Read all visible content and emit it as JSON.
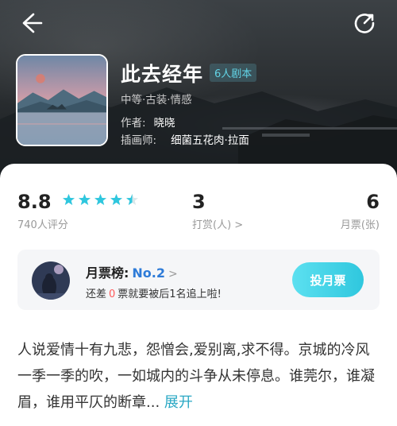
{
  "hero": {
    "title": "此去经年",
    "tag": "6人剧本",
    "genre": "中等·古装·情感",
    "author_label": "作者:",
    "author": "晓晓",
    "illustrator_label": "插画师:",
    "illustrator": "细菌五花肉·拉面"
  },
  "icons": {
    "back": "back-arrow-icon",
    "share": "share-icon"
  },
  "stats": {
    "rating": "8.8",
    "rating_label": "740人评分",
    "stars": 4.5,
    "rewards": "3",
    "rewards_label": "打赏(人) >",
    "monthly_votes": "6",
    "monthly_votes_label": "月票(张)"
  },
  "rank": {
    "title": "月票榜:",
    "position": "No.2",
    "chevron": ">",
    "sub_prefix": "还差",
    "sub_zero": "0",
    "sub_suffix": "票就要被后1名追上啦!",
    "button": "投月票"
  },
  "description": {
    "text": "人说爱情十有九悲，怨憎会,爱别离,求不得。京城的冷风一季一季的吹，一如城内的斗争从未停息。谁莞尔，谁凝眉，谁用平仄的断章...",
    "expand": "展开"
  },
  "colors": {
    "accent": "#2fc7de",
    "rank_blue": "#2e7bd8",
    "warning": "#ff5a5a"
  }
}
